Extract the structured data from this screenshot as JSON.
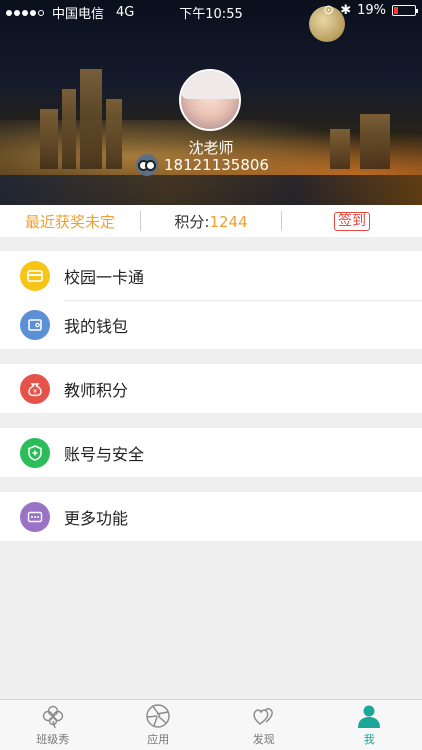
{
  "status_bar": {
    "carrier": "中国电信",
    "network": "4G",
    "time": "下午10:55",
    "battery": "19%",
    "battery_level": 0.19
  },
  "profile": {
    "name": "沈老师",
    "phone": "18121135806"
  },
  "info_strip": {
    "award": "最近获奖未定",
    "score_label": "积分:",
    "score_value": "1244",
    "signin": "签到"
  },
  "menu": {
    "campus_card": {
      "label": "校园一卡通",
      "icon": "card-icon",
      "color": "#f5c518"
    },
    "wallet": {
      "label": "我的钱包",
      "icon": "wallet-icon",
      "color": "#5b8fd6"
    },
    "teacher_points": {
      "label": "教师积分",
      "icon": "money-bag-icon",
      "color": "#e4534a"
    },
    "account_security": {
      "label": "账号与安全",
      "icon": "shield-icon",
      "color": "#2cbd5a"
    },
    "more": {
      "label": "更多功能",
      "icon": "more-icon",
      "color": "#9a73c6"
    }
  },
  "tabbar": {
    "tabs": [
      {
        "label": "班级秀",
        "icon": "clover-icon",
        "active": false
      },
      {
        "label": "应用",
        "icon": "aperture-icon",
        "active": false
      },
      {
        "label": "发现",
        "icon": "hearts-icon",
        "active": false
      },
      {
        "label": "我",
        "icon": "person-icon",
        "active": true
      }
    ]
  },
  "colors": {
    "accent": "#1aa79a",
    "highlight": "#f0a030",
    "signin_red": "#e4473c"
  }
}
